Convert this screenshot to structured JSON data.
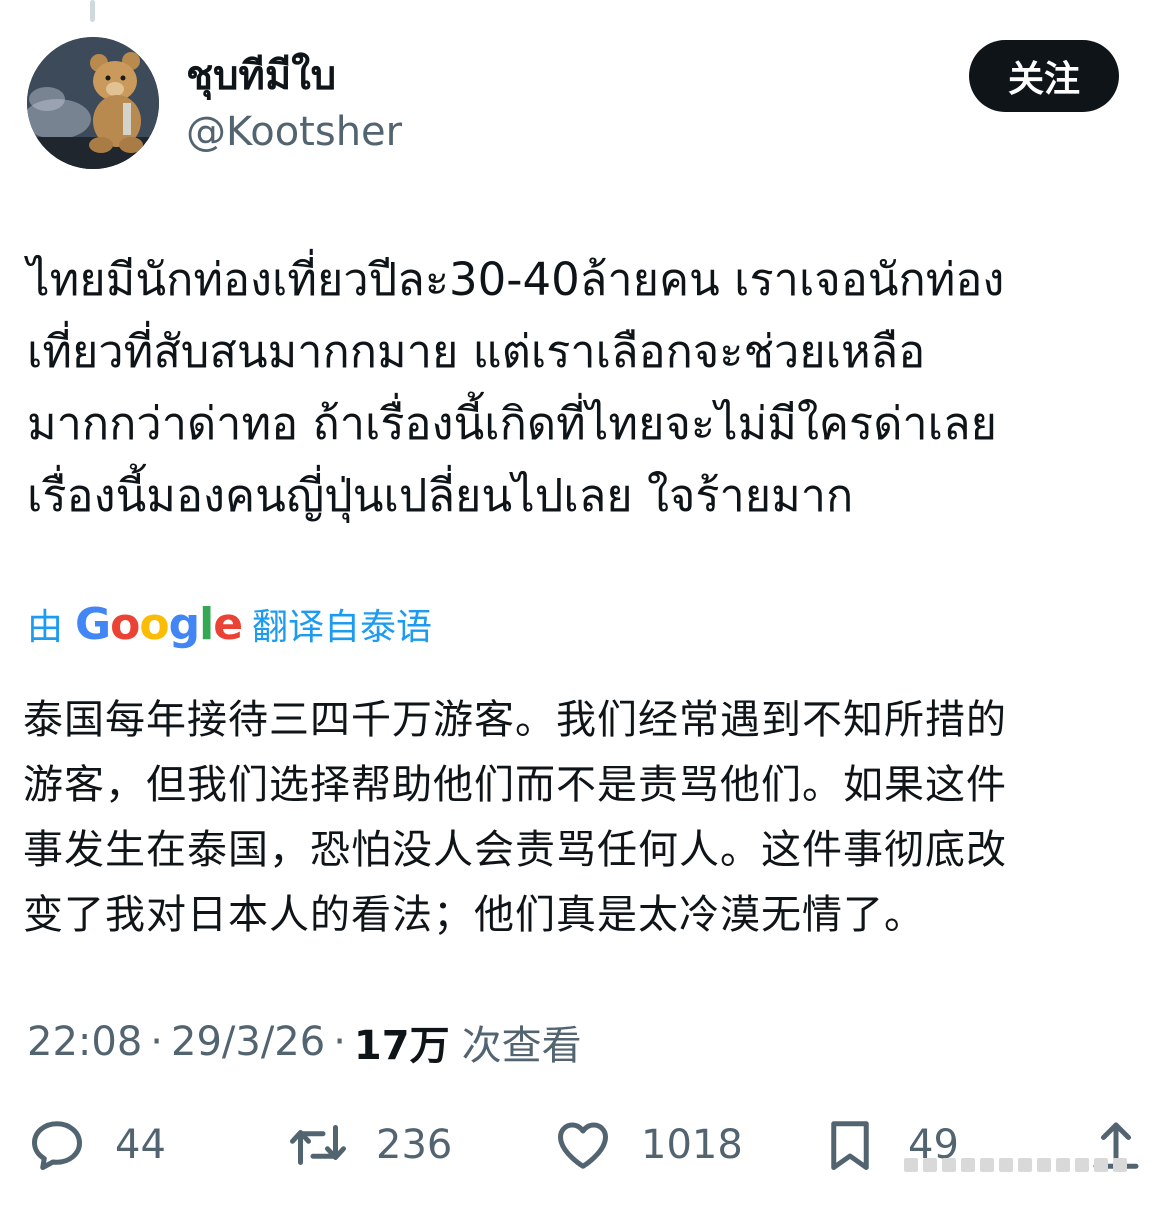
{
  "user": {
    "display_name": "ชุบทีมีใบ",
    "handle": "@Kootsher",
    "avatar_icon": "teddy-bear-avatar"
  },
  "follow_button": {
    "label": "关注"
  },
  "tweet": {
    "text": "ไทยมีนักท่องเที่ยวปีละ30-40ล้ายคน เราเจอนักท่อง\nเที่ยวที่สับสนมากกมาย แต่เราเลือกจะช่วยเหลือ\nมากกว่าด่าทอ ถ้าเรื่องนี้เกิดที่ไทยจะไม่มีใครด่าเลย\nเรื่องนี้มองคนญี่ปุ่นเปลี่ยนไปเลย ใจร้ายมาก",
    "translated_prefix": "由",
    "translated_brand": "Google",
    "translated_suffix": "翻译自泰语",
    "translation": "泰国每年接待三四千万游客。我们经常遇到不知所措的\n游客，但我们选择帮助他们而不是责骂他们。如果这件\n事发生在泰国，恐怕没人会责骂任何人。这件事彻底改\n变了我对日本人的看法；他们真是太冷漠无情了。"
  },
  "meta": {
    "time": "22:08",
    "separator": "·",
    "date": "29/3/26",
    "views_count": "17万",
    "views_label": "次查看"
  },
  "actions": {
    "replies": "44",
    "retweets": "236",
    "likes": "1018",
    "bookmarks": "49"
  },
  "colors": {
    "text": "#0f1419",
    "secondary": "#536471",
    "link_blue": "#1d9bf0",
    "button_bg": "#0f1419",
    "google_blue": "#4285F4",
    "google_red": "#EA4335",
    "google_yellow": "#FBBC05",
    "google_green": "#34A853"
  }
}
